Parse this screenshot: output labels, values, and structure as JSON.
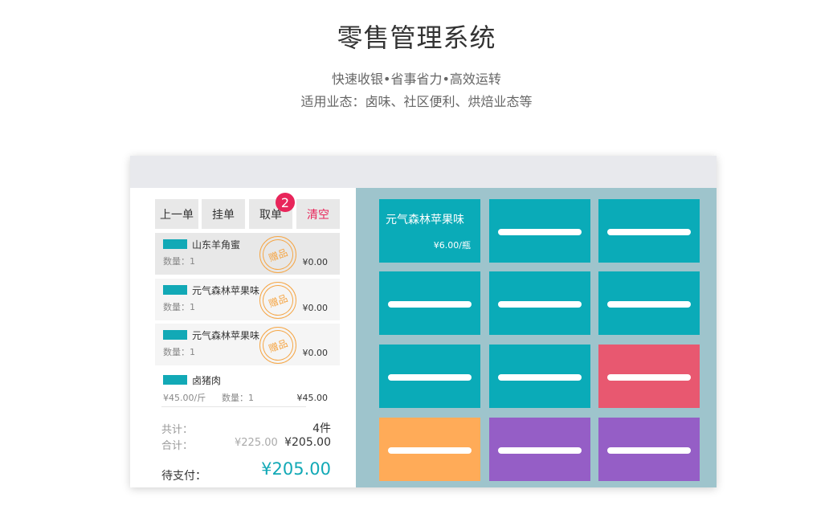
{
  "header": {
    "title": "零售管理系统",
    "subtitle": "快速收银•省事省力•高效运转",
    "subtitle2": "适用业态：卤味、社区便利、烘焙业态等"
  },
  "toolbar": {
    "prev_label": "上一单",
    "hold_label": "挂单",
    "retrieve_label": "取单",
    "retrieve_badge": "2",
    "clear_label": "清空"
  },
  "order": {
    "items": [
      {
        "name": "山东羊角蜜",
        "qty": "数量：1",
        "price": "¥0.00",
        "stamp": "赠品"
      },
      {
        "name": "元气森林苹果味",
        "qty": "数量：1",
        "price": "¥0.00",
        "stamp": "赠品"
      },
      {
        "name": "元气森林苹果味",
        "qty": "数量：1",
        "price": "¥0.00",
        "stamp": "赠品"
      },
      {
        "name": "卤猪肉",
        "unit_price": "¥45.00/斤",
        "qty": "数量：1",
        "price": "¥45.00"
      }
    ],
    "count_label": "共计：",
    "count_value": "4件",
    "total_label": "合计：",
    "original_total": "¥225.00",
    "total_value": "¥205.00",
    "pay_label": "待支付：",
    "pay_value": "¥205.00"
  },
  "products": {
    "first": {
      "name": "元气森林苹果味",
      "price": "¥6.00/瓶"
    }
  },
  "colors": {
    "teal": "#0aabb8",
    "red": "#e85870",
    "orange": "#ffab58",
    "purple": "#955ec6",
    "accent_red": "#e8255a"
  }
}
